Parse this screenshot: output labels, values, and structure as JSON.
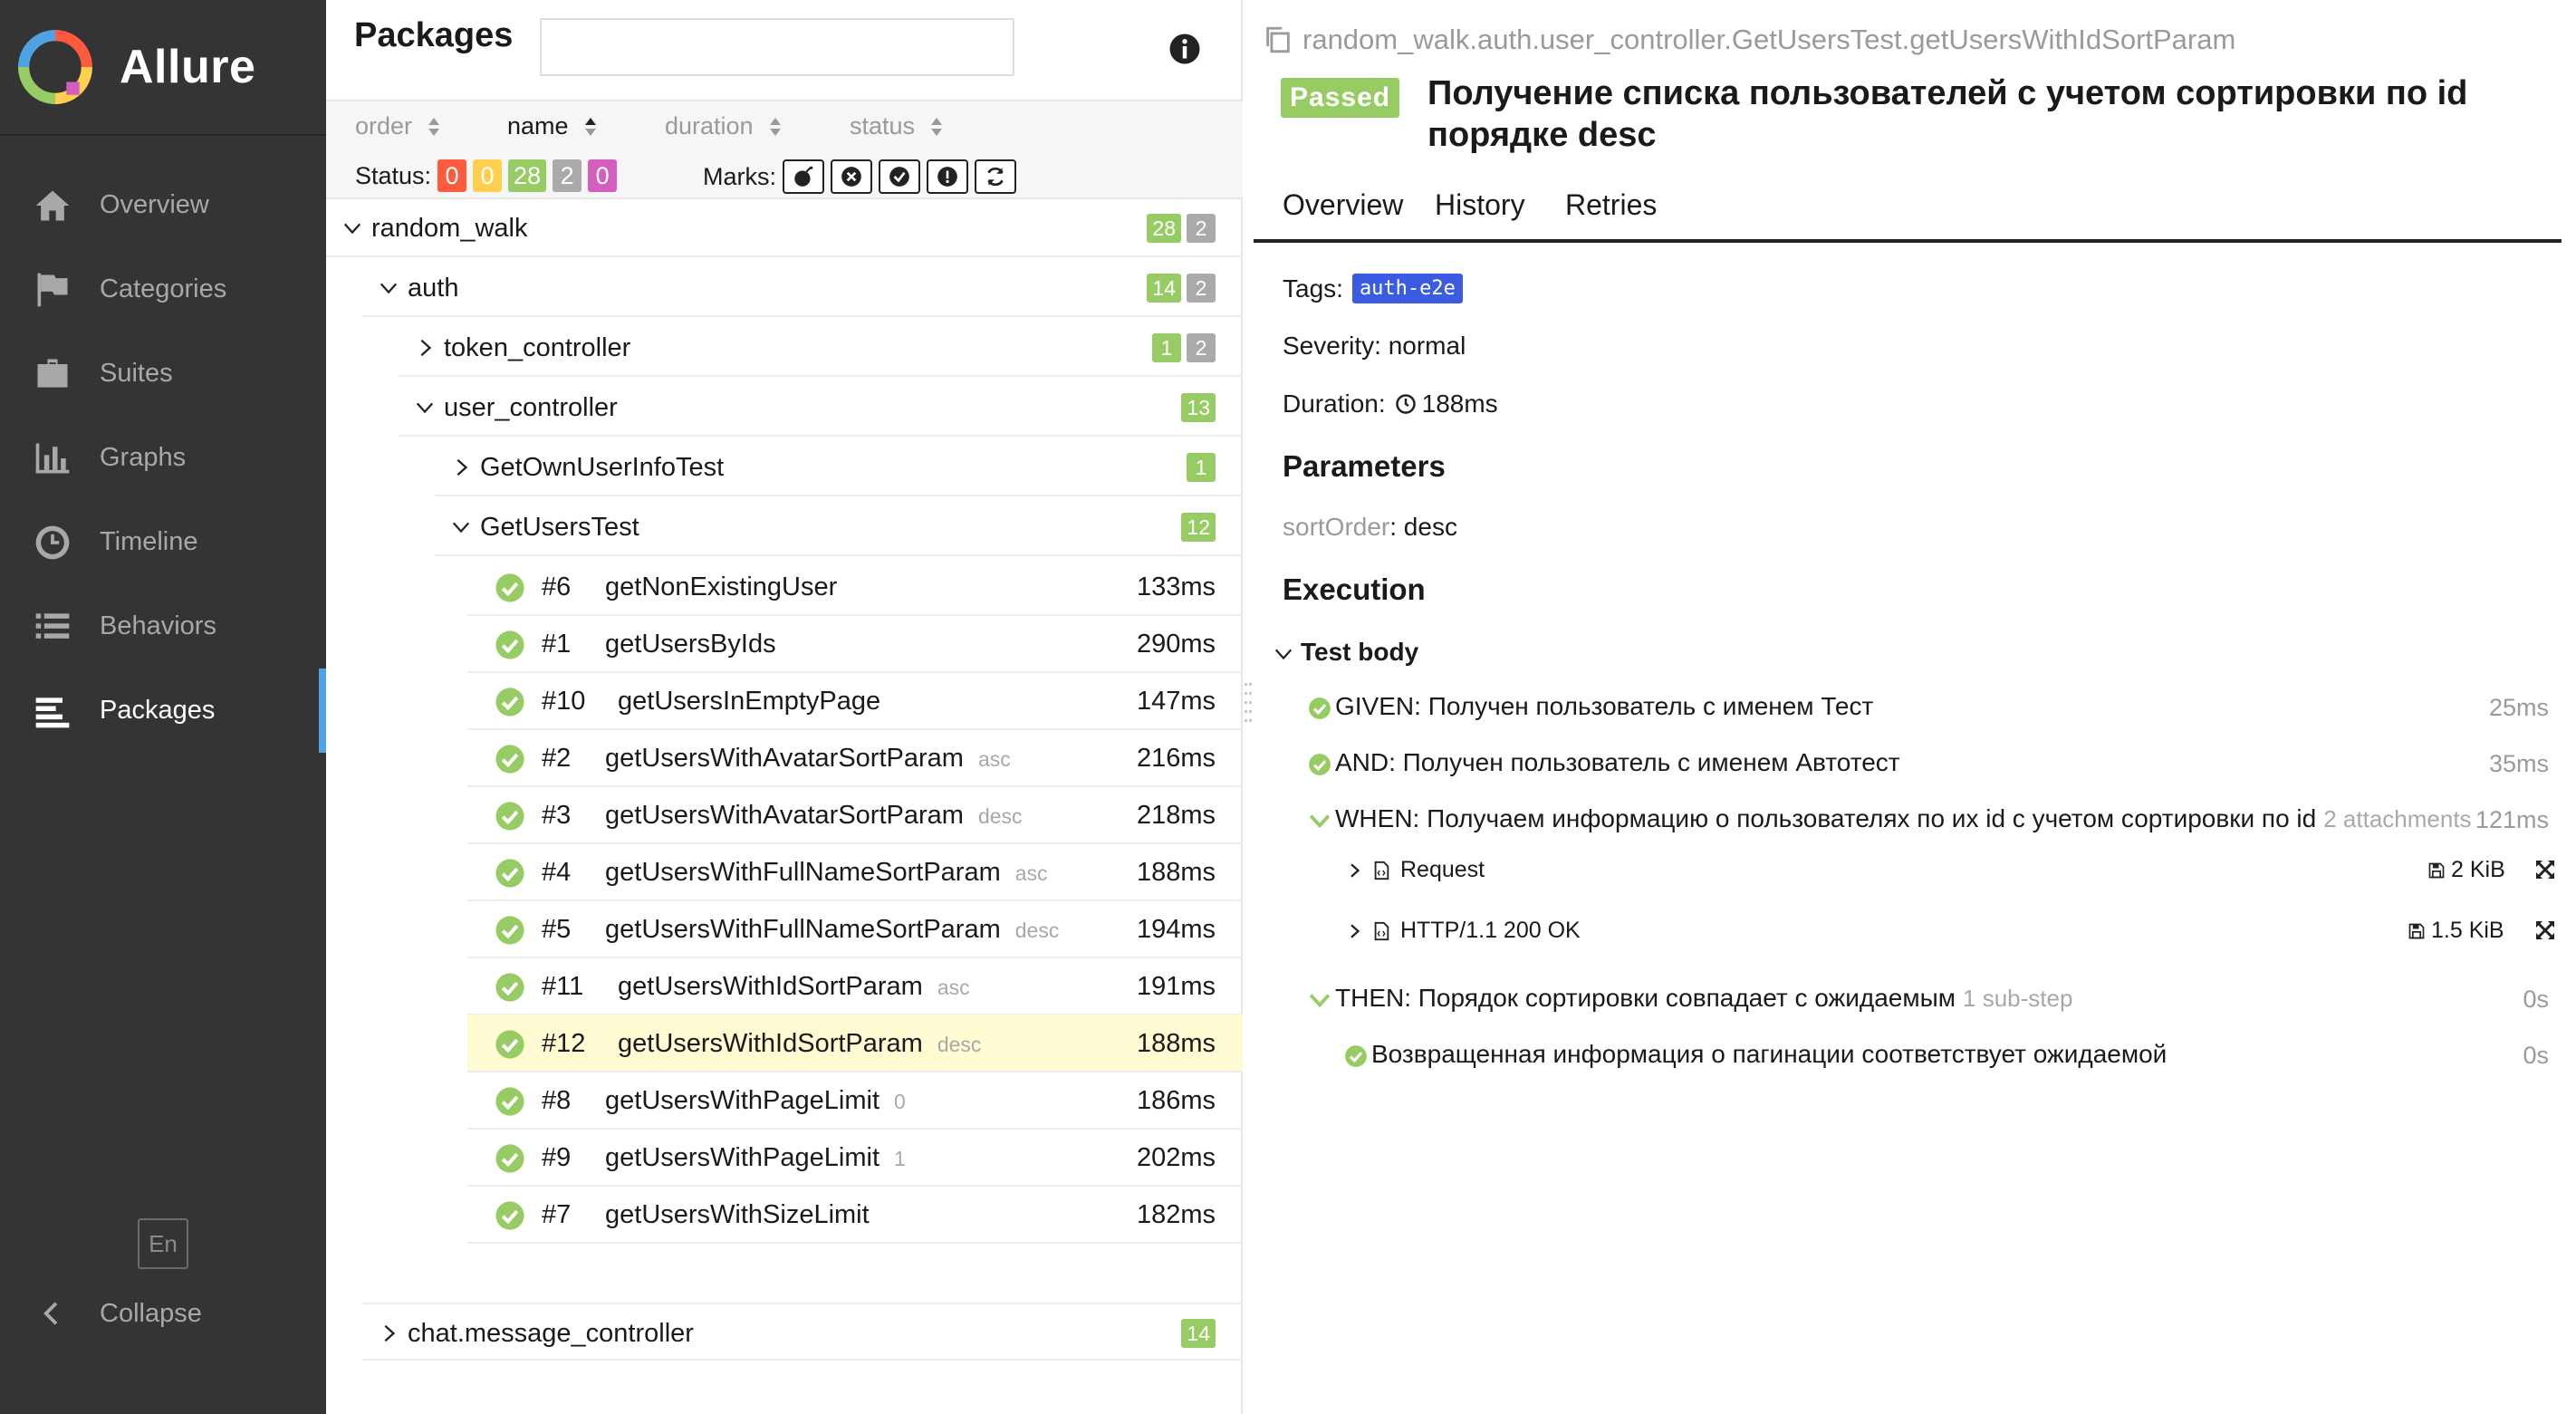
{
  "app": {
    "brand": "Allure",
    "language": "En",
    "collapse_label": "Collapse"
  },
  "sidebar": {
    "items": [
      {
        "label": "Overview",
        "icon": "home-icon"
      },
      {
        "label": "Categories",
        "icon": "flag-icon"
      },
      {
        "label": "Suites",
        "icon": "briefcase-icon"
      },
      {
        "label": "Graphs",
        "icon": "bar-chart-icon"
      },
      {
        "label": "Timeline",
        "icon": "clock-icon"
      },
      {
        "label": "Behaviors",
        "icon": "list-icon"
      },
      {
        "label": "Packages",
        "icon": "align-left-icon",
        "active": true
      }
    ]
  },
  "tree": {
    "title": "Packages",
    "search": {
      "value": "",
      "placeholder": ""
    },
    "sort": {
      "order": "order",
      "name": "name",
      "duration": "duration",
      "status": "status"
    },
    "status_label": "Status:",
    "status_counts": {
      "failed": "0",
      "broken": "0",
      "passed": "28",
      "skipped": "2",
      "unknown": "0"
    },
    "marks_label": "Marks:",
    "groups": {
      "random_walk": {
        "name": "random_walk",
        "passed": "28",
        "skipped": "2"
      },
      "auth": {
        "name": "auth",
        "passed": "14",
        "skipped": "2"
      },
      "token_controller": {
        "name": "token_controller",
        "passed": "1",
        "skipped": "2"
      },
      "user_controller": {
        "name": "user_controller",
        "passed": "13"
      },
      "get_own_user_info": {
        "name": "GetOwnUserInfoTest",
        "passed": "1"
      },
      "get_users_test": {
        "name": "GetUsersTest",
        "passed": "12"
      },
      "chat_message": {
        "name": "chat.message_controller",
        "passed": "14"
      }
    },
    "tests": [
      {
        "num": "#6",
        "name": "getNonExistingUser",
        "param": "",
        "duration": "133ms"
      },
      {
        "num": "#1",
        "name": "getUsersByIds",
        "param": "",
        "duration": "290ms"
      },
      {
        "num": "#10",
        "name": "getUsersInEmptyPage",
        "param": "",
        "duration": "147ms"
      },
      {
        "num": "#2",
        "name": "getUsersWithAvatarSortParam",
        "param": "asc",
        "duration": "216ms"
      },
      {
        "num": "#3",
        "name": "getUsersWithAvatarSortParam",
        "param": "desc",
        "duration": "218ms"
      },
      {
        "num": "#4",
        "name": "getUsersWithFullNameSortParam",
        "param": "asc",
        "duration": "188ms"
      },
      {
        "num": "#5",
        "name": "getUsersWithFullNameSortParam",
        "param": "desc",
        "duration": "194ms"
      },
      {
        "num": "#11",
        "name": "getUsersWithIdSortParam",
        "param": "asc",
        "duration": "191ms"
      },
      {
        "num": "#12",
        "name": "getUsersWithIdSortParam",
        "param": "desc",
        "duration": "188ms",
        "selected": true
      },
      {
        "num": "#8",
        "name": "getUsersWithPageLimit",
        "param": "0",
        "duration": "186ms"
      },
      {
        "num": "#9",
        "name": "getUsersWithPageLimit",
        "param": "1",
        "duration": "202ms"
      },
      {
        "num": "#7",
        "name": "getUsersWithSizeLimit",
        "param": "",
        "duration": "182ms"
      }
    ]
  },
  "detail": {
    "fullname": "random_walk.auth.user_controller.GetUsersTest.getUsersWithIdSortParam",
    "status": "Passed",
    "title": "Получение списка пользователей с учетом сортировки по id порядке desc",
    "tabs": [
      "Overview",
      "History",
      "Retries"
    ],
    "tags_label": "Tags:",
    "tag": "auth-e2e",
    "severity": "Severity: normal",
    "duration_label": "Duration:",
    "duration": "188ms",
    "parameters_heading": "Parameters",
    "param_name": "sortOrder",
    "param_value": ": desc",
    "execution_heading": "Execution",
    "test_body": "Test body",
    "steps": [
      {
        "text": "GIVEN: Получен пользователь с именем Тест",
        "duration": "25ms"
      },
      {
        "text": "AND: Получен пользователь с именем Автотест",
        "duration": "35ms"
      },
      {
        "text": "WHEN: Получаем информацию о пользователях по их id с учетом сортировки по id",
        "meta": "2 attachments",
        "duration": "121ms"
      },
      {
        "text": "THEN: Порядок сортировки совпадает с ожидаемым",
        "meta": "1 sub-step",
        "duration": "0s"
      },
      {
        "text": "Возвращенная информация о пагинации соответствует ожидаемой",
        "duration": "0s"
      }
    ],
    "attachments": [
      {
        "name": "Request",
        "size": "2 KiB"
      },
      {
        "name": "HTTP/1.1 200 OK",
        "size": "1.5 KiB"
      }
    ]
  },
  "colors": {
    "passed": "#97cc64",
    "failed": "#fd5a3e",
    "broken": "#ffd050",
    "skipped": "#aaaaaa",
    "unknown": "#d35ebe",
    "sidebar": "#343434",
    "selected_row": "#fffbd3",
    "tag": "#3b5be0",
    "active_marker": "#4fa3e5"
  }
}
